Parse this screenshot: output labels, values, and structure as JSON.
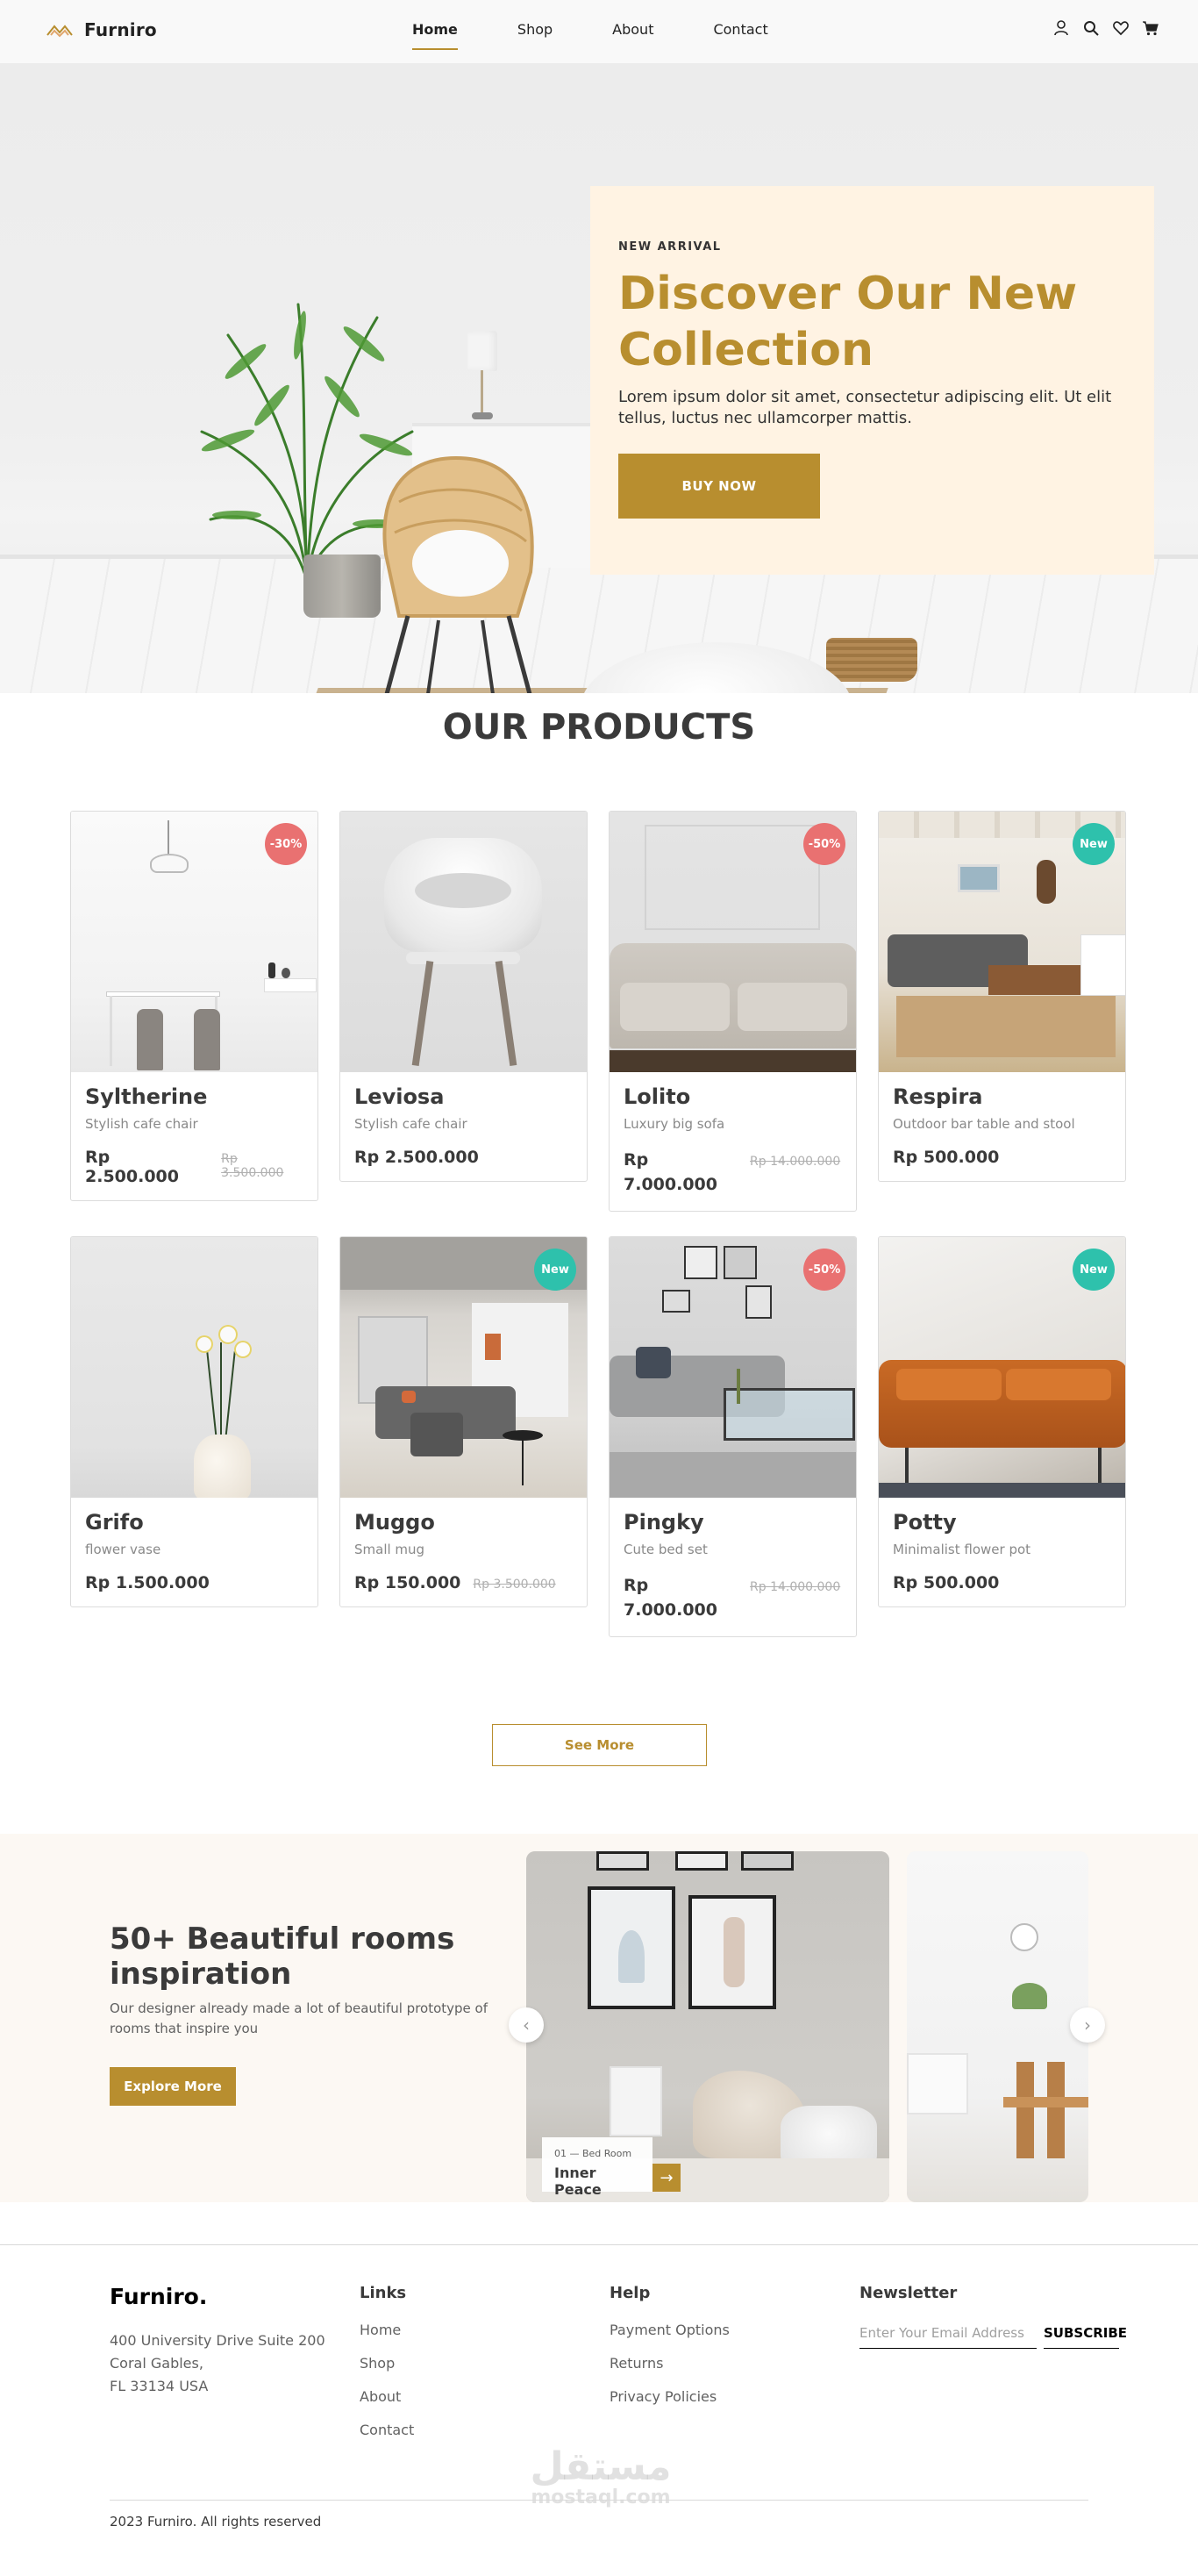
{
  "brand": {
    "name": "Furniro",
    "accent": "#b88e2f"
  },
  "nav": {
    "items": [
      {
        "label": "Home",
        "active": true
      },
      {
        "label": "Shop",
        "active": false
      },
      {
        "label": "About",
        "active": false
      },
      {
        "label": "Contact",
        "active": false
      }
    ],
    "icons": [
      "user-icon",
      "search-icon",
      "heart-icon",
      "cart-icon"
    ]
  },
  "hero": {
    "eyebrow": "New Arrival",
    "title": "Discover Our New Collection",
    "text": "Lorem ipsum dolor sit amet, consectetur adipiscing elit. Ut elit tellus, luctus nec ullamcorper mattis.",
    "button": "BUY NOW",
    "card_color": "#fff3e3"
  },
  "products": {
    "title": "OUR PRODUCTS",
    "items": [
      {
        "name": "Syltherine",
        "desc": "Stylish cafe chair",
        "price": "Rp 2.500.000",
        "old_price": "Rp 3.500.000",
        "badge": "-30%",
        "badge_type": "discount"
      },
      {
        "name": "Leviosa",
        "desc": "Stylish cafe chair",
        "price": "Rp 2.500.000",
        "old_price": "",
        "badge": "",
        "badge_type": ""
      },
      {
        "name": "Lolito",
        "desc": "Luxury big sofa",
        "price": "Rp 7.000.000",
        "old_price": "Rp 14.000.000",
        "badge": "-50%",
        "badge_type": "discount"
      },
      {
        "name": "Respira",
        "desc": "Outdoor bar table and stool",
        "price": "Rp 500.000",
        "old_price": "",
        "badge": "New",
        "badge_type": "new"
      },
      {
        "name": "Grifo",
        "desc": "flower vase",
        "price": "Rp 1.500.000",
        "old_price": "",
        "badge": "",
        "badge_type": ""
      },
      {
        "name": "Muggo",
        "desc": "Small mug",
        "price": "Rp 150.000",
        "old_price": "Rp 3.500.000",
        "badge": "New",
        "badge_type": "new"
      },
      {
        "name": "Pingky",
        "desc": "Cute bed set",
        "price": "Rp 7.000.000",
        "old_price": "Rp 14.000.000",
        "badge": "-50%",
        "badge_type": "discount"
      },
      {
        "name": "Potty",
        "desc": "Minimalist flower pot",
        "price": "Rp 500.000",
        "old_price": "",
        "badge": "New",
        "badge_type": "new"
      }
    ],
    "see_more": "See More"
  },
  "rooms": {
    "title": "50+ Beautiful rooms inspiration",
    "desc": "Our designer already made a lot of beautiful prototype of rooms that inspire you",
    "button": "Explore More",
    "slide_label_sub": "01 — Bed Room",
    "slide_label_title": "Inner Peace"
  },
  "footer": {
    "brand": "Furniro.",
    "address": [
      "400 University Drive Suite 200",
      "Coral Gables,",
      "FL 33134 USA"
    ],
    "links_head": "Links",
    "links": [
      "Home",
      "Shop",
      "About",
      "Contact"
    ],
    "help_head": "Help",
    "help": [
      "Payment Options",
      "Returns",
      "Privacy Policies"
    ],
    "newsletter_head": "Newsletter",
    "newsletter_placeholder": "Enter Your Email Address",
    "subscribe": "SUBSCRIBE",
    "copyright": "2023 Furniro. All rights reserved",
    "watermark_ar": "مستقل",
    "watermark_en": "mostaql.com"
  }
}
